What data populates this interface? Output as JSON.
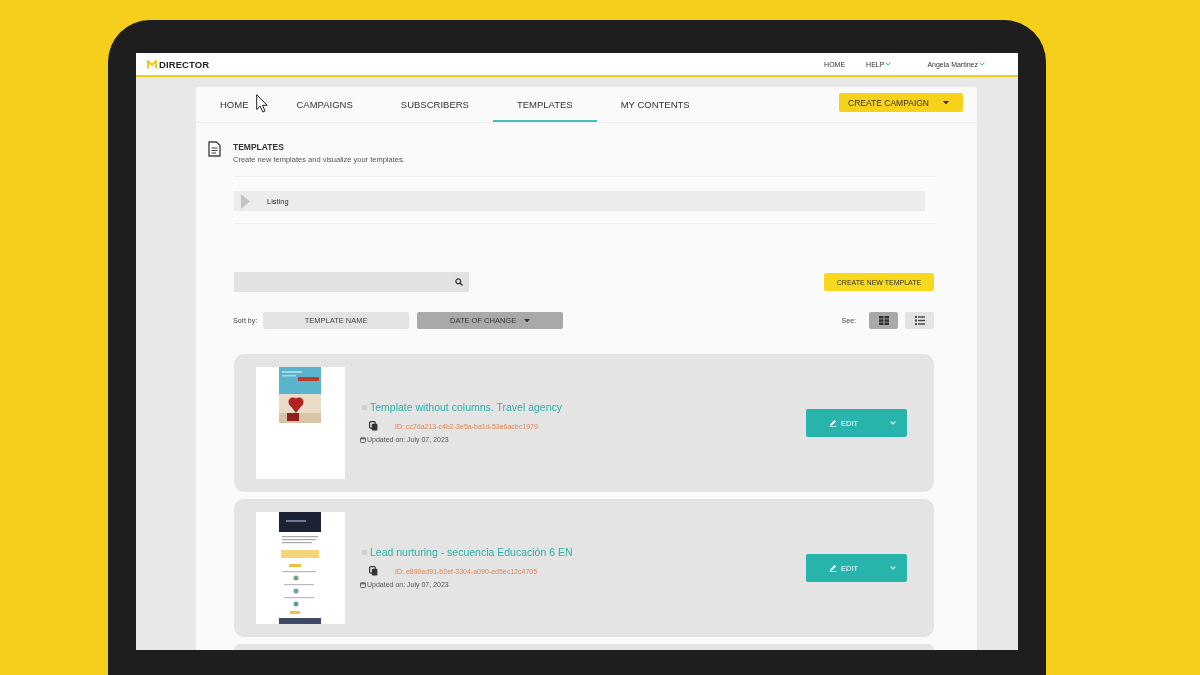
{
  "header": {
    "logo": "DIRECTOR",
    "links": [
      {
        "label": "HOME",
        "dropdown": false
      },
      {
        "label": "HELP",
        "dropdown": true
      },
      {
        "label": "Angela Martinez",
        "dropdown": true
      }
    ]
  },
  "nav": {
    "tabs": [
      {
        "label": "HOME",
        "selected": false
      },
      {
        "label": "CAMPAIGNS",
        "selected": false
      },
      {
        "label": "SUBSCRIBERS",
        "selected": false
      },
      {
        "label": "TEMPLATES",
        "selected": true
      },
      {
        "label": "MY CONTENTS",
        "selected": false
      }
    ],
    "action": "CREATE CAMPAIGN"
  },
  "page": {
    "title": "TEMPLATES",
    "subtitle": "Create new templates and visualize your templates."
  },
  "breadcrumb": {
    "label": "Listing"
  },
  "toolbar": {
    "create_button": "CREATE NEW TEMPLATE"
  },
  "sort": {
    "label": "Sort by:",
    "options": [
      {
        "label": "TEMPLATE NAME",
        "selected": false
      },
      {
        "label": "DATE OF CHANGE",
        "selected": true
      }
    ]
  },
  "view": {
    "label": "See:",
    "options": [
      {
        "kind": "grid",
        "selected": true
      },
      {
        "kind": "list",
        "selected": false
      }
    ]
  },
  "templates": [
    {
      "kind": "short",
      "name": "Template without columns. Travel agency",
      "id": "ID: cc7da213-c4b2-3e5a-ba1d-53e6acbc1979",
      "updated": "Updated on: July 07, 2023",
      "edit": "EDIT"
    },
    {
      "kind": "long",
      "name": "Lead nurturing - secuencia Educación 6 EN",
      "id": "ID: e890ed91-b2ef-3304-a090-ed5ec12c4705",
      "updated": "Updated on: July 07, 2023",
      "edit": "EDIT"
    }
  ]
}
